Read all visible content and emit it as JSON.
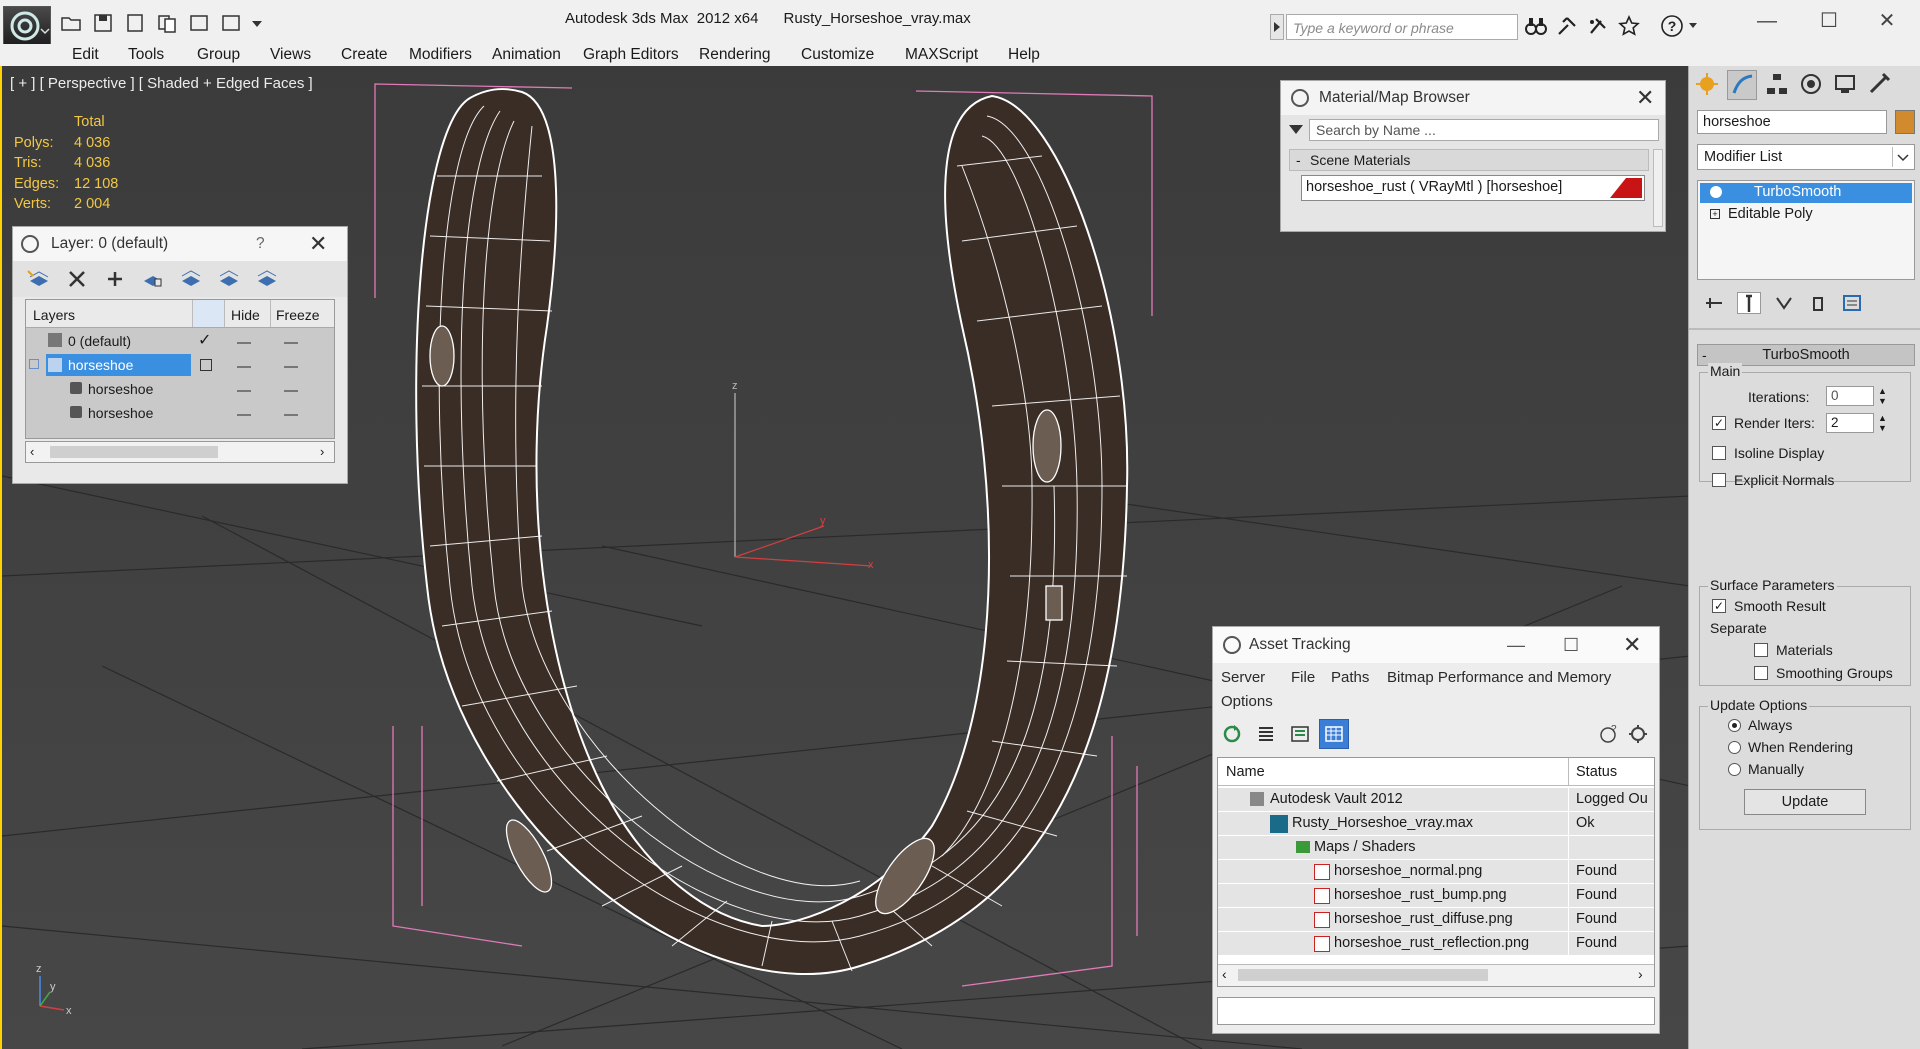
{
  "titlebar": {
    "app_title": "Autodesk 3ds Max  2012 x64",
    "file_title": "Rusty_Horseshoe_vray.max",
    "search_placeholder": "Type a keyword or phrase",
    "min": "—",
    "max": "☐",
    "close": "✕"
  },
  "menu": [
    "Edit",
    "Tools",
    "Group",
    "Views",
    "Create",
    "Modifiers",
    "Animation",
    "Graph Editors",
    "Rendering",
    "Customize",
    "MAXScript",
    "Help"
  ],
  "viewport": {
    "label": "[ + ] [ Perspective ] [ Shaded + Edged Faces ]",
    "stats": {
      "header": "Total",
      "rows": [
        {
          "label": "Polys:",
          "value": "4 036"
        },
        {
          "label": "Tris:",
          "value": "4 036"
        },
        {
          "label": "Edges:",
          "value": "12 108"
        },
        {
          "label": "Verts:",
          "value": "2 004"
        }
      ]
    },
    "gizmo_axes": [
      "z",
      "y",
      "x"
    ]
  },
  "layer_panel": {
    "title": "Layer: 0 (default)",
    "help": "?",
    "col_layers": "Layers",
    "col_hide": "Hide",
    "col_freeze": "Freeze",
    "rows": [
      "0 (default)",
      "horseshoe",
      "horseshoe",
      "horseshoe"
    ]
  },
  "material_browser": {
    "title": "Material/Map Browser",
    "search_placeholder": "Search by Name ...",
    "section_toggle": "-",
    "section": "Scene Materials",
    "material": "horseshoe_rust  ( VRayMtl ) [horseshoe]"
  },
  "asset_tracking": {
    "title": "Asset Tracking",
    "menu": [
      "Server",
      "File",
      "Paths",
      "Bitmap Performance and Memory",
      "Options"
    ],
    "col_name": "Name",
    "col_status": "Status",
    "rows": [
      {
        "name": "Autodesk Vault 2012",
        "status": "Logged Ou"
      },
      {
        "name": "Rusty_Horseshoe_vray.max",
        "status": "Ok"
      },
      {
        "name": "Maps / Shaders",
        "status": ""
      },
      {
        "name": "horseshoe_normal.png",
        "status": "Found"
      },
      {
        "name": "horseshoe_rust_bump.png",
        "status": "Found"
      },
      {
        "name": "horseshoe_rust_diffuse.png",
        "status": "Found"
      },
      {
        "name": "horseshoe_rust_reflection.png",
        "status": "Found"
      }
    ]
  },
  "command_panel": {
    "object_name": "horseshoe",
    "modifier_list": "Modifier List",
    "stack": [
      "TurboSmooth",
      "Editable Poly"
    ],
    "rollout_toggle": "-",
    "rollout_title": "TurboSmooth",
    "main_group": "Main",
    "iterations_label": "Iterations:",
    "iterations_value": "0",
    "render_iters_label": "Render Iters:",
    "render_iters_value": "2",
    "isoline": "Isoline Display",
    "explicit_normals": "Explicit Normals",
    "surface_params": "Surface Parameters",
    "smooth_result": "Smooth Result",
    "separate": "Separate",
    "materials": "Materials",
    "smoothing_groups": "Smoothing Groups",
    "update_options": "Update Options",
    "always": "Always",
    "when_rendering": "When Rendering",
    "manually": "Manually",
    "update_button": "Update"
  },
  "colors": {
    "selection": "#3b8fe0",
    "stats": "#f2c843",
    "viewport_bg": "#3f3f3f",
    "material_swatch": "#c81414",
    "object_color": "#d28a2e"
  }
}
